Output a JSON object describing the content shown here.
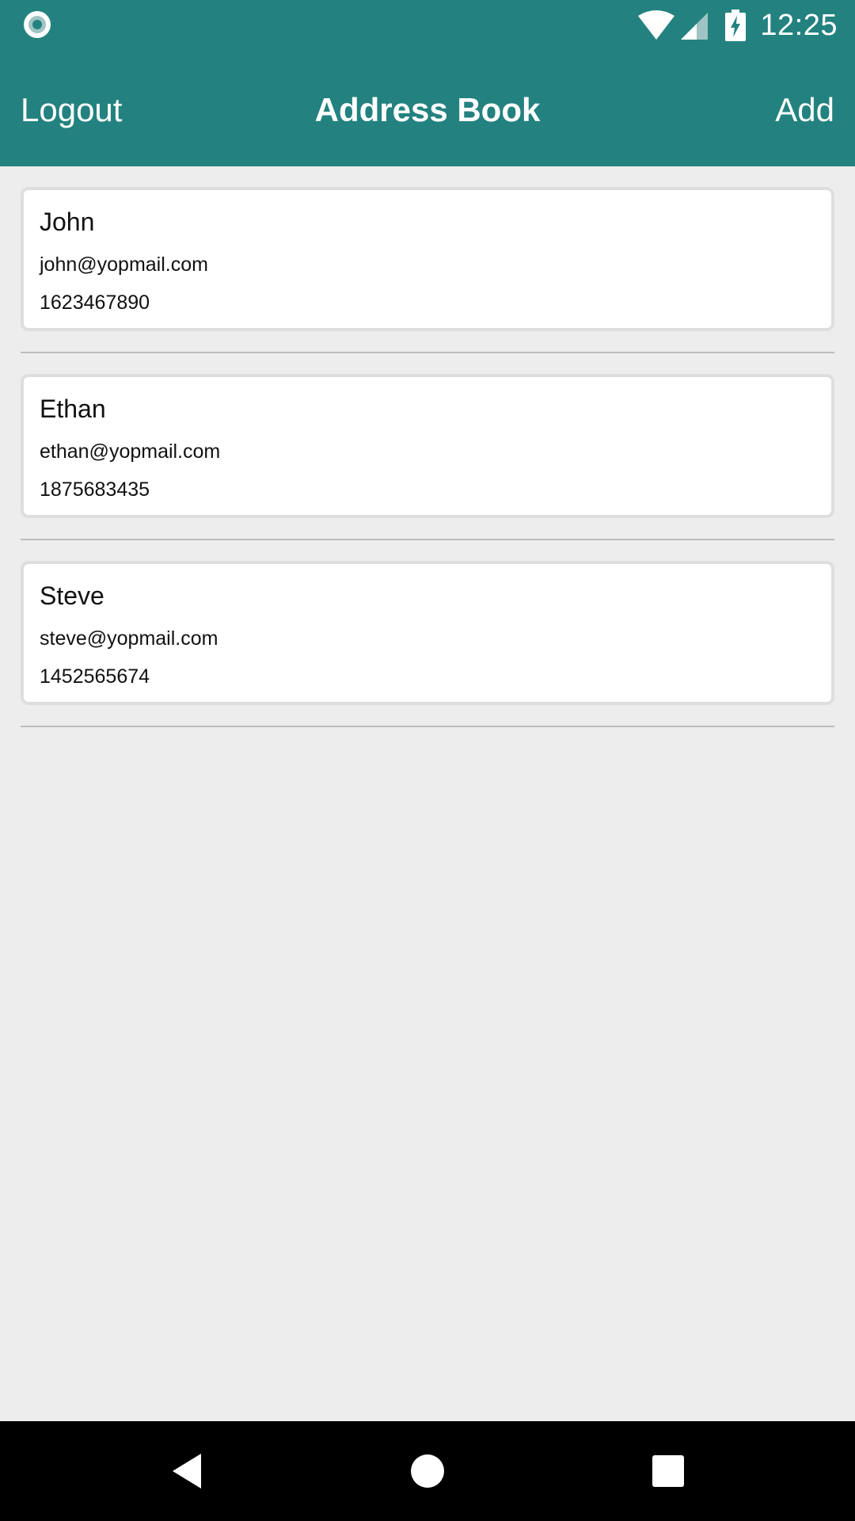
{
  "status_bar": {
    "time": "12:25",
    "icons": [
      "radio-dot-icon",
      "wifi-icon",
      "signal-icon",
      "battery-charging-icon"
    ]
  },
  "app_bar": {
    "title": "Address Book",
    "left_action": "Logout",
    "right_action": "Add"
  },
  "contacts": [
    {
      "name": "John",
      "email": "john@yopmail.com",
      "phone": "1623467890"
    },
    {
      "name": "Ethan",
      "email": "ethan@yopmail.com",
      "phone": "1875683435"
    },
    {
      "name": "Steve",
      "email": "steve@yopmail.com",
      "phone": "1452565674"
    }
  ],
  "nav_bar": {
    "icons": [
      "back-icon",
      "home-icon",
      "recent-apps-icon"
    ]
  },
  "colors": {
    "primary": "#23827f",
    "background": "#ededed",
    "card": "#ffffff",
    "card_border": "#dedede",
    "divider": "#bdbdbd",
    "nav_bar": "#000000"
  }
}
